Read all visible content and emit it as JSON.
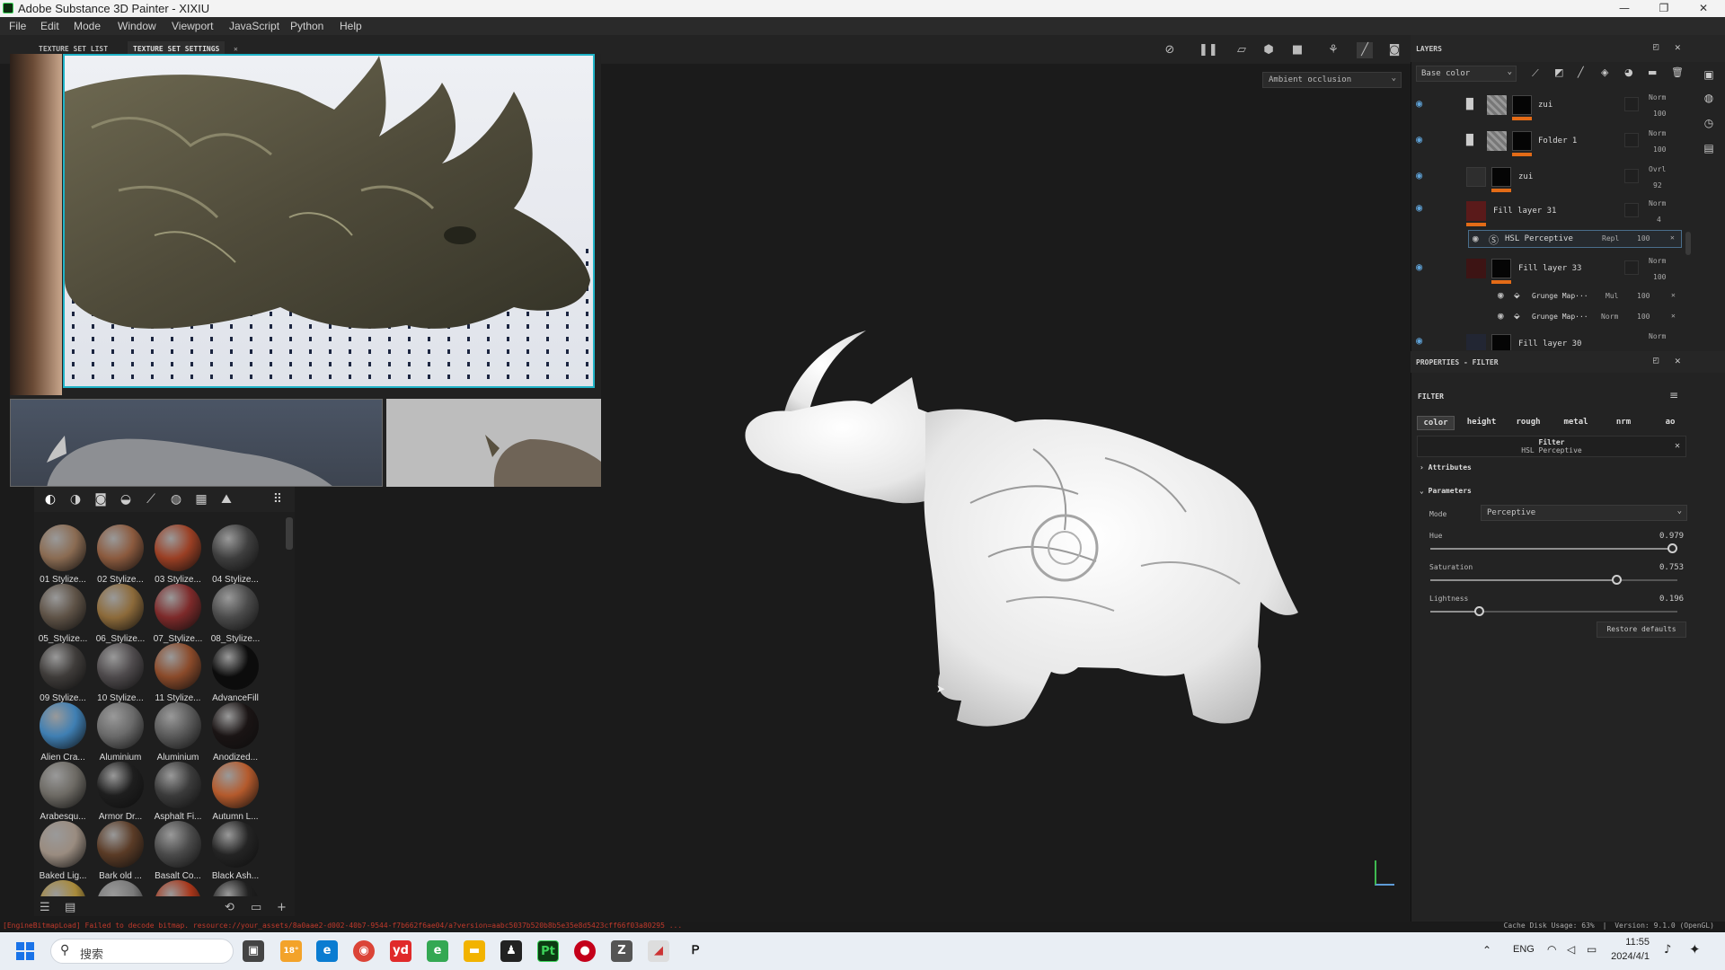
{
  "window": {
    "title": "Adobe Substance 3D Painter - XIXIU",
    "minimize": "—",
    "maximize": "❐",
    "close": "✕"
  },
  "menu": [
    "File",
    "Edit",
    "Mode",
    "Window",
    "Viewport",
    "JavaScript",
    "Python",
    "Help"
  ],
  "texture_set": {
    "tab_list": "TEXTURE SET LIST",
    "tab_settings": "TEXTURE SET SETTINGS",
    "tab_close": "✕"
  },
  "viewport": {
    "display_mode": "Ambient occlusion",
    "axis_glyph": "L"
  },
  "shelf": {
    "materials": [
      {
        "label": "01 Stylize...",
        "color": "#8a6b52"
      },
      {
        "label": "02 Stylize...",
        "color": "#8b5a3e"
      },
      {
        "label": "03 Stylize...",
        "color": "#9a3f24"
      },
      {
        "label": "04 Stylize...",
        "color": "#3e3e3e"
      },
      {
        "label": "05_Stylize...",
        "color": "#5e5246"
      },
      {
        "label": "06_Stylize...",
        "color": "#8c6a3a"
      },
      {
        "label": "07_Stylize...",
        "color": "#7d2a2a"
      },
      {
        "label": "08_Stylize...",
        "color": "#4a4a4a"
      },
      {
        "label": "09 Stylize...",
        "color": "#3f3c3a"
      },
      {
        "label": "10 Stylize...",
        "color": "#4e4a4c"
      },
      {
        "label": "11 Stylize...",
        "color": "#8a4a2a"
      },
      {
        "label": "AdvanceFill",
        "color": "#0c0c0c"
      },
      {
        "label": "Alien Cra...",
        "color": "#3f7fb3"
      },
      {
        "label": "Aluminium",
        "color": "#6a6a6a"
      },
      {
        "label": "Aluminium",
        "color": "#5a5a5a"
      },
      {
        "label": "Anodized...",
        "color": "#1a1414"
      },
      {
        "label": "Arabesqu...",
        "color": "#6d6a64"
      },
      {
        "label": "Armor Dr...",
        "color": "#1e1e1e"
      },
      {
        "label": "Asphalt Fi...",
        "color": "#3b3b3b"
      },
      {
        "label": "Autumn L...",
        "color": "#b45a2c"
      },
      {
        "label": "Baked Lig...",
        "color": "#9a8c80"
      },
      {
        "label": "Bark old ...",
        "color": "#5a3b26"
      },
      {
        "label": "Basalt Co...",
        "color": "#4a4a4a"
      },
      {
        "label": "Black Ash...",
        "color": "#242424"
      },
      {
        "label": "",
        "color": "#a88a3a"
      },
      {
        "label": "",
        "color": "#7a7a7a"
      },
      {
        "label": "",
        "color": "#a8361a"
      },
      {
        "label": "",
        "color": "#202020"
      }
    ]
  },
  "status": {
    "error": "[EngineBitmapLoad] Failed to decode bitmap. resource://your_assets/8a0aae2-d002-40b7-9544-f7b662f6ae04/a?version=aabc5037b520b8b5e35e8d5423cff66f03a80295 ...",
    "cache": "Cache Disk Usage:",
    "cache_value": "63%",
    "version": "Version: 9.1.0 (OpenGL)"
  },
  "taskbar": {
    "search_placeholder": "搜索",
    "weather": "18°",
    "lang": "ENG",
    "time": "11:55",
    "date": "2024/4/1"
  },
  "layers_panel": {
    "title": "LAYERS",
    "channel": "Base color",
    "layers": [
      {
        "name": "zui",
        "blend": "Norm",
        "opacity": "100"
      },
      {
        "name": "Folder 1",
        "blend": "Norm",
        "opacity": "100"
      },
      {
        "name": "zui",
        "blend": "Ovrl",
        "opacity": "92"
      },
      {
        "name": "Fill layer 31",
        "blend": "Norm",
        "opacity": "4"
      },
      {
        "name": "HSL Perceptive",
        "blend": "Repl",
        "opacity": "100"
      },
      {
        "name": "Fill layer 33",
        "blend": "Norm",
        "opacity": "100"
      },
      {
        "name": "Grunge Map···",
        "blend": "Mul",
        "opacity": "100"
      },
      {
        "name": "Grunge Map···",
        "blend": "Norm",
        "opacity": "100"
      },
      {
        "name": "Fill layer 30",
        "blend": "Norm",
        "opacity": ""
      }
    ]
  },
  "properties": {
    "title": "PROPERTIES - FILTER",
    "section": "FILTER",
    "channels": [
      "color",
      "height",
      "rough",
      "metal",
      "nrm",
      "ao"
    ],
    "filter_title": "Filter",
    "filter_name": "HSL Perceptive",
    "attributes": "Attributes",
    "parameters": "Parameters",
    "mode_label": "Mode",
    "mode_value": "Perceptive",
    "params": [
      {
        "label": "Hue",
        "value": "0.979",
        "fraction": 0.979
      },
      {
        "label": "Saturation",
        "value": "0.753",
        "fraction": 0.753
      },
      {
        "label": "Lightness",
        "value": "0.196",
        "fraction": 0.196
      }
    ],
    "restore": "Restore defaults"
  },
  "colors": {
    "accent_orange": "#e36b17",
    "eye_blue": "#5ea1d6",
    "selection_cyan": "#1fb3c7"
  }
}
